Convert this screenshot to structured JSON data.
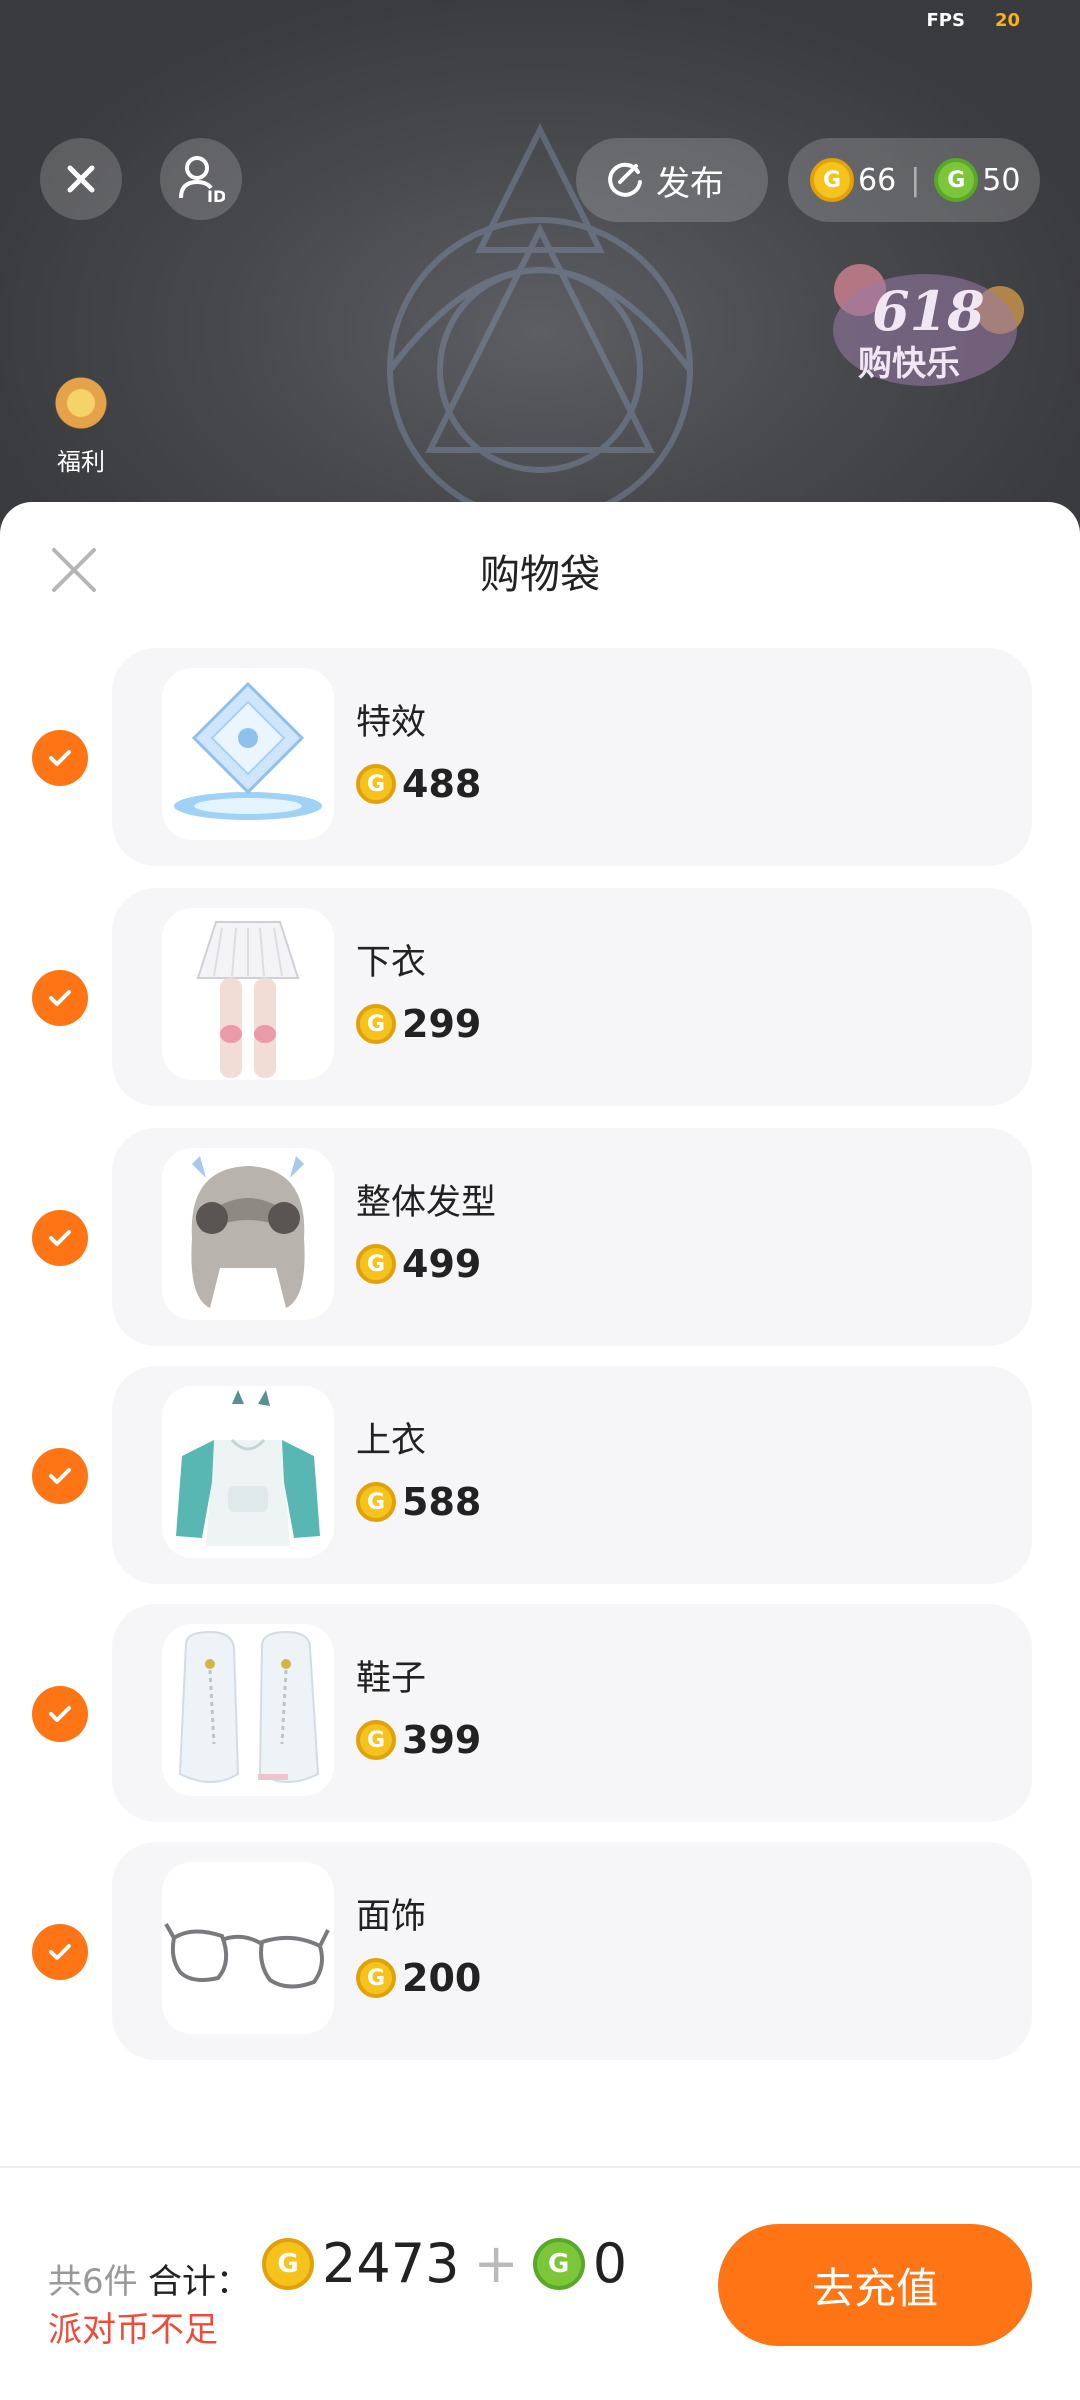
{
  "status": {
    "fps_label": "FPS",
    "fps_value": "20"
  },
  "top": {
    "publish_label": "发布",
    "gold_coins": "66",
    "green_coins": "50",
    "welfare_label": "福利",
    "event_badge": "618购快乐"
  },
  "sheet": {
    "title": "购物袋",
    "items": [
      {
        "name": "特效",
        "price": "488"
      },
      {
        "name": "下衣",
        "price": "299"
      },
      {
        "name": "整体发型",
        "price": "499"
      },
      {
        "name": "上衣",
        "price": "588"
      },
      {
        "name": "鞋子",
        "price": "399"
      },
      {
        "name": "面饰",
        "price": "200"
      }
    ]
  },
  "footer": {
    "count_label": "共6件",
    "total_label": "合计：",
    "gold_total": "2473",
    "plus": "+",
    "green_total": "0",
    "warning": "派对币不足",
    "recharge_button": "去充值"
  },
  "colors": {
    "accent": "#ff7414",
    "gold": "#f6c21c",
    "green": "#7cc63a",
    "warning": "#ef4b3a"
  }
}
